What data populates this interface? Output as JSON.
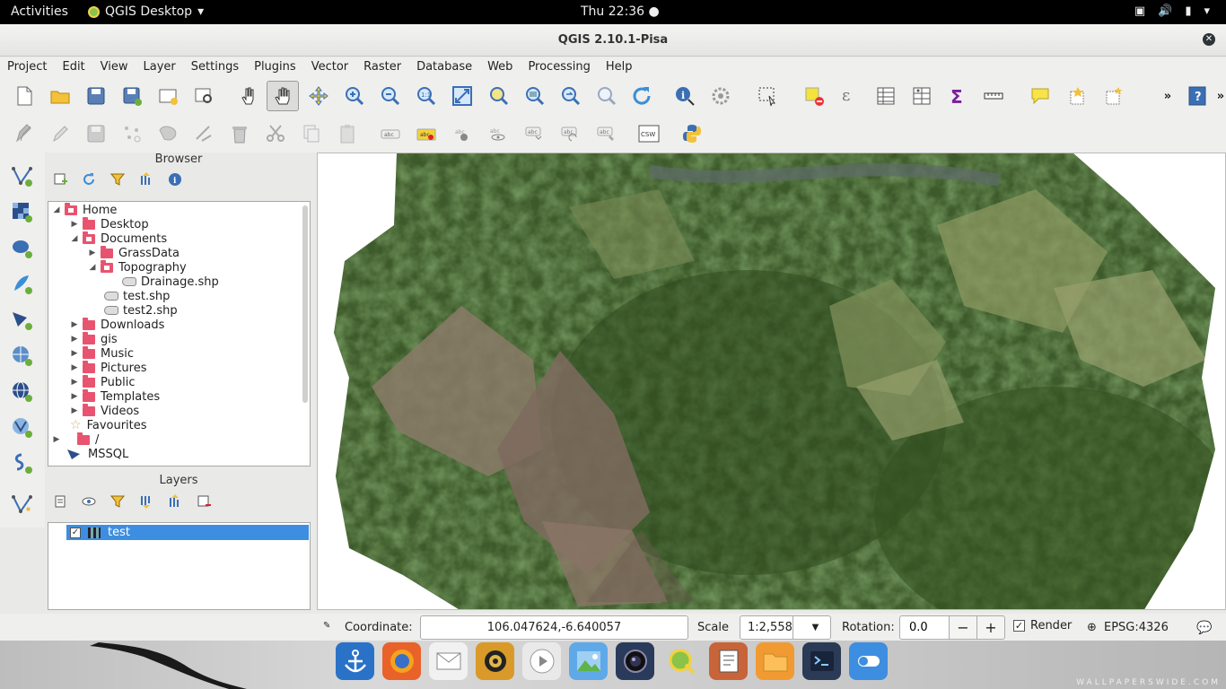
{
  "topbar": {
    "activities": "Activities",
    "app_menu": "QGIS Desktop",
    "clock": "Thu 22:36"
  },
  "window": {
    "title": "QGIS 2.10.1-Pisa"
  },
  "menubar": [
    "Project",
    "Edit",
    "View",
    "Layer",
    "Settings",
    "Plugins",
    "Vector",
    "Raster",
    "Database",
    "Web",
    "Processing",
    "Help"
  ],
  "toolbar2": {
    "csw_label": "CSW"
  },
  "browser": {
    "title": "Browser",
    "tree": [
      {
        "label": "Home",
        "expanded": true,
        "icon": "home-folder-icon"
      },
      {
        "label": "Desktop",
        "icon": "folder-icon"
      },
      {
        "label": "Documents",
        "expanded": true,
        "icon": "home-folder-icon"
      },
      {
        "label": "GrassData",
        "icon": "folder-icon"
      },
      {
        "label": "Topography",
        "expanded": true,
        "icon": "home-folder-icon"
      },
      {
        "label": "Drainage.shp",
        "icon": "shapefile-icon"
      },
      {
        "label": "test.shp",
        "icon": "shapefile-icon"
      },
      {
        "label": "test2.shp",
        "icon": "shapefile-icon"
      },
      {
        "label": "Downloads",
        "icon": "folder-icon"
      },
      {
        "label": "gis",
        "icon": "folder-icon"
      },
      {
        "label": "Music",
        "icon": "folder-icon"
      },
      {
        "label": "Pictures",
        "icon": "folder-icon"
      },
      {
        "label": "Public",
        "icon": "folder-icon"
      },
      {
        "label": "Templates",
        "icon": "folder-icon"
      },
      {
        "label": "Videos",
        "icon": "folder-icon"
      },
      {
        "label": "Favourites",
        "icon": "star-icon"
      },
      {
        "label": "/",
        "icon": "folder-icon"
      },
      {
        "label": "MSSQL",
        "icon": "mssql-icon"
      }
    ]
  },
  "layers": {
    "title": "Layers",
    "items": [
      {
        "label": "test",
        "checked": true,
        "selected": true
      }
    ]
  },
  "statusbar": {
    "coordinate_label": "Coordinate:",
    "coordinate_value": "106.047624,-6.640057",
    "scale_label": "Scale",
    "scale_value": "1:2,558",
    "rotation_label": "Rotation:",
    "rotation_value": "0.0",
    "rot_minus": "−",
    "rot_plus": "+",
    "render_label": "Render",
    "render_checked": true,
    "crs": "EPSG:4326"
  },
  "wallpaper_watermark": "WALLPAPERSWIDE.COM",
  "colors": {
    "accent": "#3d8ee0",
    "folder": "#e8546f",
    "bg": "#efefed"
  }
}
